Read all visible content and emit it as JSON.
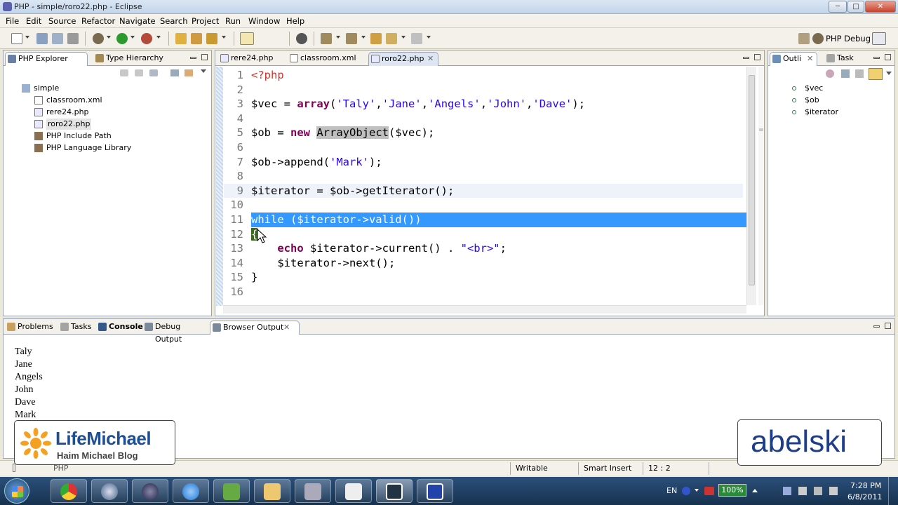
{
  "window": {
    "title": "PHP - simple/roro22.php - Eclipse",
    "min": "─",
    "max": "□",
    "close": "✕"
  },
  "menu": [
    "File",
    "Edit",
    "Source",
    "Refactor",
    "Navigate",
    "Search",
    "Project",
    "Run",
    "Window",
    "Help"
  ],
  "perspective": {
    "label": "PHP Debug"
  },
  "explorer": {
    "tabs": [
      "PHP Explorer",
      "Type Hierarchy"
    ],
    "project": "simple",
    "files": [
      "classroom.xml",
      "rere24.php",
      "roro22.php",
      "PHP Include Path",
      "PHP Language Library"
    ]
  },
  "editor": {
    "tabs": [
      "rere24.php",
      "classroom.xml",
      "roro22.php"
    ],
    "lines": [
      {
        "n": "1",
        "segs": [
          {
            "t": "<?php",
            "c": "kw2"
          }
        ]
      },
      {
        "n": "2",
        "segs": []
      },
      {
        "n": "3",
        "segs": [
          {
            "t": "$vec = ",
            "c": ""
          },
          {
            "t": "array",
            "c": "kw"
          },
          {
            "t": "(",
            "c": ""
          },
          {
            "t": "'Taly'",
            "c": "str"
          },
          {
            "t": ",",
            "c": ""
          },
          {
            "t": "'Jane'",
            "c": "str"
          },
          {
            "t": ",",
            "c": ""
          },
          {
            "t": "'Angels'",
            "c": "str"
          },
          {
            "t": ",",
            "c": ""
          },
          {
            "t": "'John'",
            "c": "str"
          },
          {
            "t": ",",
            "c": ""
          },
          {
            "t": "'Dave'",
            "c": "str"
          },
          {
            "t": ");",
            "c": ""
          }
        ]
      },
      {
        "n": "4",
        "segs": []
      },
      {
        "n": "5",
        "segs": [
          {
            "t": "$ob = ",
            "c": ""
          },
          {
            "t": "new",
            "c": "kw"
          },
          {
            "t": " ",
            "c": ""
          },
          {
            "t": "ArrayObject",
            "c": "hl"
          },
          {
            "t": "($vec);",
            "c": ""
          }
        ]
      },
      {
        "n": "6",
        "segs": []
      },
      {
        "n": "7",
        "segs": [
          {
            "t": "$ob->append(",
            "c": ""
          },
          {
            "t": "'Mark'",
            "c": "str"
          },
          {
            "t": ");",
            "c": ""
          }
        ]
      },
      {
        "n": "8",
        "segs": []
      },
      {
        "n": "9",
        "segs": [
          {
            "t": "$iterator = $ob->getIterator();",
            "c": ""
          }
        ]
      },
      {
        "n": "10",
        "segs": []
      },
      {
        "n": "11",
        "segs": [
          {
            "t": "while ($iterator->valid())",
            "c": "sel"
          }
        ]
      },
      {
        "n": "12",
        "segs": [
          {
            "t": "{",
            "c": ""
          }
        ]
      },
      {
        "n": "13",
        "segs": [
          {
            "t": "    ",
            "c": ""
          },
          {
            "t": "echo",
            "c": "kw"
          },
          {
            "t": " $iterator->current() . ",
            "c": ""
          },
          {
            "t": "\"<br>\"",
            "c": "str"
          },
          {
            "t": ";",
            "c": ""
          }
        ]
      },
      {
        "n": "14",
        "segs": [
          {
            "t": "    $iterator->next();",
            "c": ""
          }
        ]
      },
      {
        "n": "15",
        "segs": [
          {
            "t": "}",
            "c": ""
          }
        ]
      },
      {
        "n": "16",
        "segs": []
      }
    ]
  },
  "outline": {
    "tabs": [
      "Outli",
      "Task"
    ],
    "items": [
      "$vec",
      "$ob",
      "$iterator"
    ]
  },
  "bottom": {
    "tabs": [
      "Problems",
      "Tasks",
      "Console",
      "Debug Output",
      "Browser Output"
    ],
    "output": [
      "Taly",
      "Jane",
      "Angels",
      "John",
      "Dave",
      "Mark"
    ]
  },
  "status": {
    "crumb": "PHP",
    "writable": "Writable",
    "insert": "Smart Insert",
    "position": "12 : 2"
  },
  "watermarks": {
    "left_title": "LifeMichael",
    "left_sub": "Haim Michael Blog",
    "right": "abelski"
  },
  "taskbar": {
    "lang": "EN",
    "battery": "100%",
    "time": "7:28 PM",
    "date": "6/8/2011"
  },
  "colors": {
    "keyword": "#7f0055",
    "string": "#2a00ff",
    "selection": "#3399ff"
  }
}
